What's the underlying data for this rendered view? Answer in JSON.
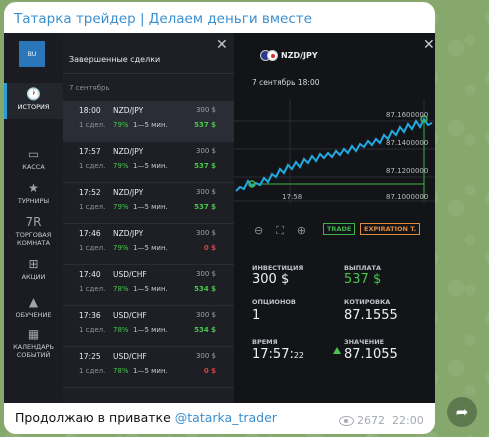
{
  "post": {
    "channel_title": "Татарка трейдер | Делаем деньги вместе",
    "caption_text": "Продолжаю в приватке ",
    "caption_link": "@tatarka_trader",
    "views": "2672",
    "time": "22:00"
  },
  "platform": {
    "logo_label": "BU",
    "nav": [
      {
        "label": "ИСТОРИЯ",
        "icon": "clock-icon",
        "glyph": "🕐"
      },
      {
        "label": "КАССА",
        "icon": "wallet-icon",
        "glyph": "▭"
      },
      {
        "label": "ТУРНИРЫ",
        "icon": "star-icon",
        "glyph": "★"
      },
      {
        "label": "ТОРГОВАЯ КОМНАТА",
        "icon": "trading-room-icon",
        "glyph": "7R"
      },
      {
        "label": "АКЦИИ",
        "icon": "gift-icon",
        "glyph": "⊞"
      },
      {
        "label": "ОБУЧЕНИЕ",
        "icon": "graduation-cap-icon",
        "glyph": "▲"
      },
      {
        "label": "КАЛЕНДАРЬ СОБЫТИЙ",
        "icon": "calendar-icon",
        "glyph": "▦"
      }
    ],
    "deals_header": "Завершенные сделки",
    "deals_date": "7 сентябрь",
    "close_glyph": "✕",
    "deals": [
      {
        "time": "18:00",
        "pair": "NZD/JPY",
        "amount": "300 $",
        "count": "1 сдел.",
        "pct": "79%",
        "duration": "1—5 мин.",
        "payout": "537 $",
        "result": "win"
      },
      {
        "time": "17:57",
        "pair": "NZD/JPY",
        "amount": "300 $",
        "count": "1 сдел.",
        "pct": "79%",
        "duration": "1—5 мин.",
        "payout": "537 $",
        "result": "win"
      },
      {
        "time": "17:52",
        "pair": "NZD/JPY",
        "amount": "300 $",
        "count": "1 сдел.",
        "pct": "79%",
        "duration": "1—5 мин.",
        "payout": "537 $",
        "result": "win"
      },
      {
        "time": "17:46",
        "pair": "NZD/JPY",
        "amount": "300 $",
        "count": "1 сдел.",
        "pct": "79%",
        "duration": "1—5 мин.",
        "payout": "0 $",
        "result": "loss"
      },
      {
        "time": "17:40",
        "pair": "USD/CHF",
        "amount": "300 $",
        "count": "1 сдел.",
        "pct": "78%",
        "duration": "1—5 мин.",
        "payout": "534 $",
        "result": "win"
      },
      {
        "time": "17:36",
        "pair": "USD/CHF",
        "amount": "300 $",
        "count": "1 сдел.",
        "pct": "78%",
        "duration": "1—5 мин.",
        "payout": "534 $",
        "result": "win"
      },
      {
        "time": "17:25",
        "pair": "USD/CHF",
        "amount": "300 $",
        "count": "1 сдел.",
        "pct": "78%",
        "duration": "1—5 мин.",
        "payout": "0 $",
        "result": "loss"
      }
    ],
    "detail": {
      "pair": "NZD/JPY",
      "datetime": "7 сентябрь 18:00",
      "price_labels": [
        "87.1600000",
        "87.1400000",
        "87.1200000",
        "87.1000000"
      ],
      "time_label": "17:58",
      "controls": [
        "⊖",
        "⛶",
        "⊕"
      ],
      "trade_btn": "TRADE",
      "expiration_btn": "EXPIRATION T.",
      "fields": {
        "investment_label": "ИНВЕСТИЦИЯ",
        "investment": "300 $",
        "payout_label": "ВЫПЛАТА",
        "payout": "537 $",
        "options_label": "ОПЦИОНОВ",
        "options": "1",
        "quote_label": "КОТИРОВКА",
        "quote": "87.1555",
        "time_label": "ВРЕМЯ",
        "time_main": "17:57:",
        "time_sec": "22",
        "value_label": "ЗНАЧЕНИЕ",
        "value": "87.1055"
      }
    }
  },
  "colors": {
    "accent_blue": "#3a8fd0",
    "profit_green": "#47c64b",
    "loss_red": "#e43d3d",
    "chart_line": "#22a9e0"
  }
}
